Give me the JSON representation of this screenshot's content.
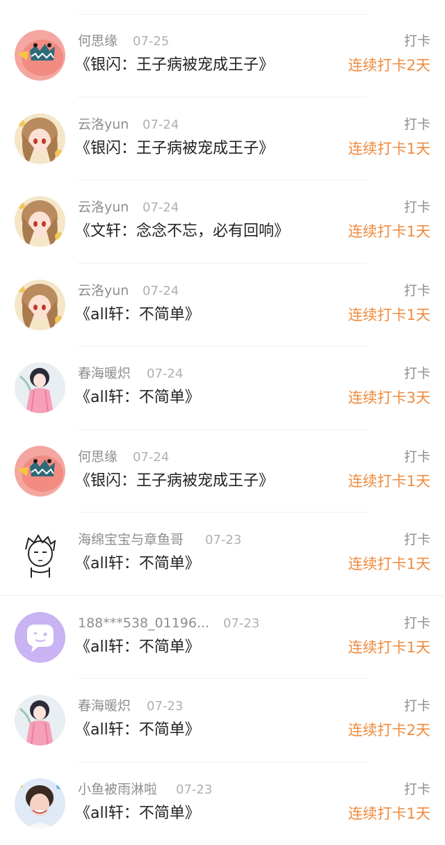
{
  "feed": {
    "items": [
      {
        "user": "何思缘",
        "date": "07-25",
        "book": "《银闪：王子病被宠成王子》",
        "action": "打卡",
        "streak": "连续打卡2天",
        "avatar": "pink-monster-icon"
      },
      {
        "user": "云洛yun",
        "date": "07-24",
        "book": "《银闪：王子病被宠成王子》",
        "action": "打卡",
        "streak": "连续打卡1天",
        "avatar": "anime-girl-icon"
      },
      {
        "user": "云洛yun",
        "date": "07-24",
        "book": "《文轩：念念不忘，必有回响》",
        "action": "打卡",
        "streak": "连续打卡1天",
        "avatar": "anime-girl-icon"
      },
      {
        "user": "云洛yun",
        "date": "07-24",
        "book": "《all轩：不简单》",
        "action": "打卡",
        "streak": "连续打卡1天",
        "avatar": "anime-girl-icon"
      },
      {
        "user": "春海暖炽",
        "date": "07-24",
        "book": "《all轩：不简单》",
        "action": "打卡",
        "streak": "连续打卡3天",
        "avatar": "dancer-girl-icon"
      },
      {
        "user": "何思缘",
        "date": "07-24",
        "book": "《银闪：王子病被宠成王子》",
        "action": "打卡",
        "streak": "连续打卡1天",
        "avatar": "pink-monster-icon"
      },
      {
        "user": "海绵宝宝与章鱼哥",
        "date": "07-23",
        "book": "《all轩：不简单》",
        "action": "打卡",
        "streak": "连续打卡1天",
        "avatar": "sketch-boy-icon"
      },
      {
        "user": "188***538_01196...",
        "date": "07-23",
        "book": "《all轩：不简单》",
        "action": "打卡",
        "streak": "连续打卡1天",
        "avatar": "chat-bubble-icon"
      },
      {
        "user": "春海暖炽",
        "date": "07-23",
        "book": "《all轩：不简单》",
        "action": "打卡",
        "streak": "连续打卡2天",
        "avatar": "dancer-girl-icon"
      },
      {
        "user": "小鱼被雨淋啦",
        "date": "07-23",
        "book": "《all轩：不简单》",
        "action": "打卡",
        "streak": "连续打卡1天",
        "avatar": "photo-person-icon"
      }
    ]
  },
  "colors": {
    "streak": "#f08a3c",
    "username": "#8e8e8e",
    "date": "#b0b0b0",
    "book": "#222222",
    "chat_avatar_bg": "#c9b3f2"
  }
}
